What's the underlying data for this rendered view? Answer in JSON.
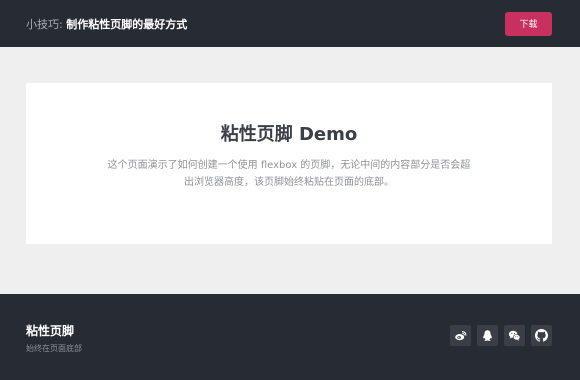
{
  "header": {
    "title_prefix": "小技巧: ",
    "title_main": "制作粘性页脚的最好方式",
    "download_label": "下载"
  },
  "card": {
    "title": "粘性页脚 Demo",
    "description": "这个页面演示了如何创建一个使用 flexbox 的页脚，无论中间的内容部分是否会超出浏览器高度，该页脚始终粘贴在页面的底部。"
  },
  "footer": {
    "title": "粘性页脚",
    "subtitle": "始终在页面底部",
    "socials": [
      {
        "icon": "weibo-icon"
      },
      {
        "icon": "qq-icon"
      },
      {
        "icon": "wechat-icon"
      },
      {
        "icon": "github-icon"
      }
    ]
  },
  "colors": {
    "header_bg": "#272b33",
    "accent": "#c7305f",
    "page_bg": "#efefef",
    "card_bg": "#ffffff"
  }
}
